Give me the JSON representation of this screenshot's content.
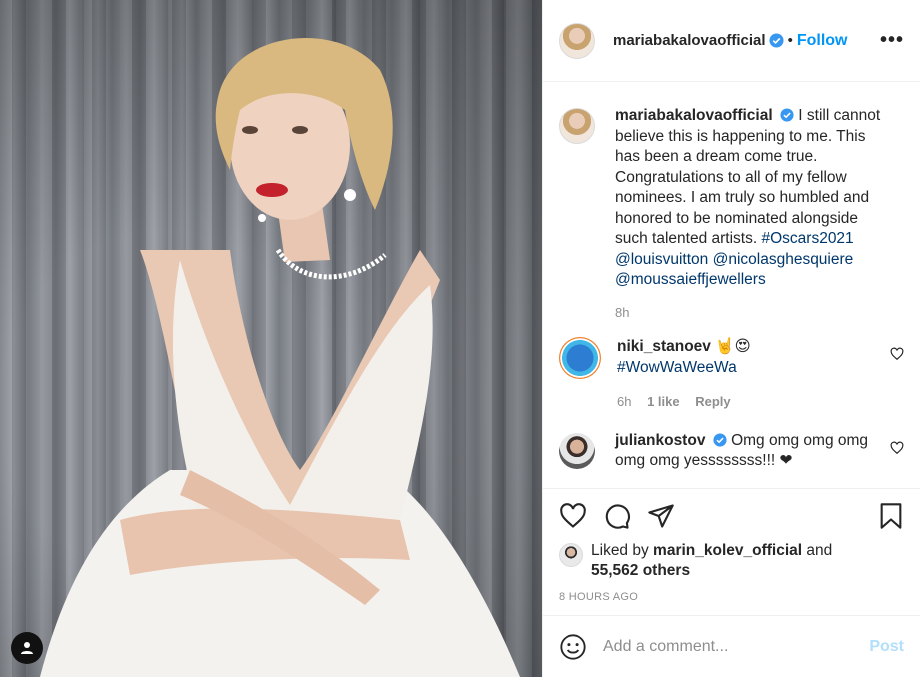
{
  "post": {
    "author": "mariabakalovaofficial",
    "follow_label": "Follow",
    "more_label": "•••",
    "photo_alt": "Woman in white gown"
  },
  "caption": {
    "author": "mariabakalovaofficial",
    "text": "I still cannot believe this is happening to me. This has been a dream come true. Congratulations to all of my fellow nominees. I am truly so humbled and honored to be nominated alongside such talented artists.",
    "hashtag": "#Oscars2021",
    "mentions": [
      "@louisvuitton",
      "@nicolasghesquiere",
      "@moussaieffjewellers"
    ],
    "time": "8h"
  },
  "comments": [
    {
      "author": "niki_stanoev",
      "text": "🤘😍",
      "hashtag": "#WowWaWeeWa",
      "time": "6h",
      "likes": "1 like",
      "reply": "Reply"
    },
    {
      "author": "juliankostov",
      "text": "Omg omg omg omg omg omg yessssssss!!! ❤"
    }
  ],
  "likes": {
    "prefix": "Liked by",
    "user": "marin_kolev_official",
    "and": "and",
    "count": "55,562 others"
  },
  "timestamp": "8 HOURS AGO",
  "comment_box": {
    "placeholder": "Add a comment...",
    "post_label": "Post"
  },
  "colors": {
    "link": "#00376b",
    "follow": "#0095f6",
    "verified": "#3897f0"
  }
}
